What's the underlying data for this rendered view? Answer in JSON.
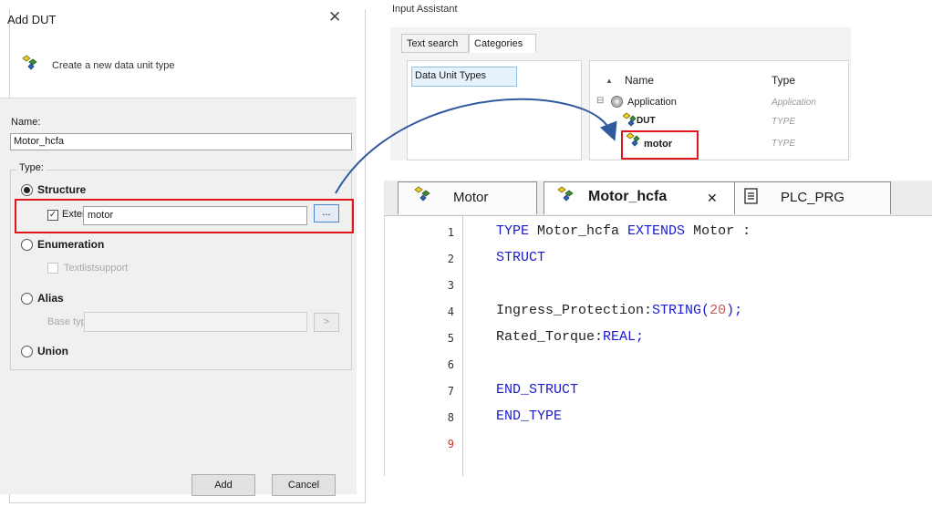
{
  "dialog": {
    "title": "Add DUT",
    "close_glyph": "✕",
    "hint": "Create a new data unit type",
    "name_label": "Name:",
    "name_value": "Motor_hcfa",
    "type_label": "Type:",
    "structure_label": "Structure",
    "extends_checked_glyph": "✓",
    "extends_label": "Extends:",
    "extends_value": "motor",
    "extends_btn": "...",
    "enumeration_label": "Enumeration",
    "textlist_label": "Textlistsupport",
    "alias_label": "Alias",
    "base_type_label": "Base type:",
    "base_btn": ">",
    "union_label": "Union",
    "add_btn": "Add",
    "cancel_btn": "Cancel"
  },
  "input_assistant": {
    "title": "Input Assistant",
    "tabs": [
      "Text search",
      "Categories"
    ],
    "category": "Data Unit Types",
    "sort_glyph": "▲",
    "col_name": "Name",
    "col_type": "Type",
    "expand_glyph": "⊟",
    "rows": [
      {
        "name": "Application",
        "type": "Application"
      },
      {
        "name": "DUT",
        "type": "TYPE"
      },
      {
        "name": "motor",
        "type": "TYPE"
      }
    ]
  },
  "editor": {
    "tabs": [
      "Motor",
      "Motor_hcfa",
      "PLC_PRG"
    ],
    "tab_close_glyph": "✕",
    "line_numbers": [
      "1",
      "2",
      "3",
      "4",
      "5",
      "6",
      "7",
      "8",
      "9"
    ],
    "code": {
      "l1_kw1": "TYPE",
      "l1_name": " Motor_hcfa ",
      "l1_kw2": "EXTENDS",
      "l1_rest": " Motor :",
      "l2": "STRUCT",
      "l4_name": "Ingress_Protection:",
      "l4_kw": "STRING",
      "l4_open": "(",
      "l4_num": "20",
      "l4_close": ");",
      "l5_name": "Rated_Torque:",
      "l5_kw": "REAL",
      "l5_semi": ";",
      "l7": "END_STRUCT",
      "l8": "END_TYPE"
    }
  },
  "colors": {
    "highlight_red": "#e0161b",
    "keyword_blue": "#1a1ad1",
    "arrow_blue": "#2f5a9e"
  }
}
